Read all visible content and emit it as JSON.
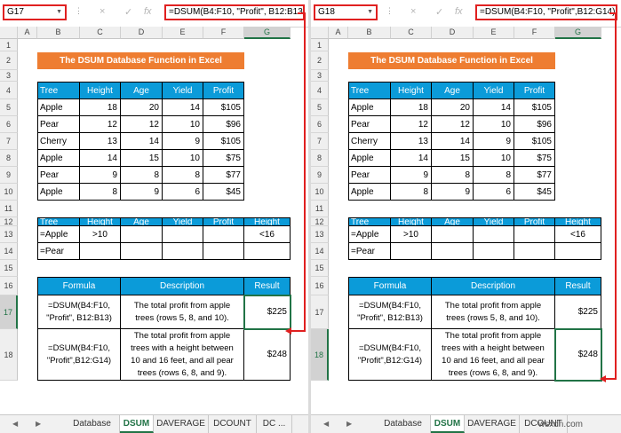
{
  "panes": [
    {
      "name_box": "G17",
      "formula": "=DSUM(B4:F10, \"Profit\", B12:B13)",
      "columns": [
        "A",
        "B",
        "C",
        "D",
        "E",
        "F",
        "G"
      ],
      "rows": [
        "1",
        "2",
        "3",
        "4",
        "5",
        "6",
        "7",
        "8",
        "9",
        "10",
        "11",
        "12",
        "13",
        "14",
        "15",
        "16",
        "17",
        "18"
      ],
      "title": "The DSUM Database Function in Excel",
      "db_headers": [
        "Tree",
        "Height",
        "Age",
        "Yield",
        "Profit"
      ],
      "db_rows": [
        [
          "Apple",
          "18",
          "20",
          "14",
          "$105"
        ],
        [
          "Pear",
          "12",
          "12",
          "10",
          "$96"
        ],
        [
          "Cherry",
          "13",
          "14",
          "9",
          "$105"
        ],
        [
          "Apple",
          "14",
          "15",
          "10",
          "$75"
        ],
        [
          "Pear",
          "9",
          "8",
          "8",
          "$77"
        ],
        [
          "Apple",
          "8",
          "9",
          "6",
          "$45"
        ]
      ],
      "crit_headers": [
        "Tree",
        "Height",
        "Age",
        "Yield",
        "Profit",
        "Height"
      ],
      "crit_row1": [
        "=Apple",
        ">10",
        "",
        "",
        "",
        "<16"
      ],
      "crit_row2": [
        "=Pear",
        "",
        "",
        "",
        "",
        ""
      ],
      "res_headers": [
        "Formula",
        "Description",
        "Result"
      ],
      "res_row1": {
        "formula": "=DSUM(B4:F10, \"Profit\", B12:B13)",
        "description": "The total profit from apple trees (rows 5, 8, and 10).",
        "result": "$225"
      },
      "res_row2": {
        "formula": "=DSUM(B4:F10, \"Profit\",B12:G14)",
        "description": "The total profit from apple trees with a height between 10 and 16 feet, and all pear trees (rows 6, 8, and 9).",
        "result": "$248"
      },
      "tabs": [
        "Database",
        "DSUM",
        "DAVERAGE",
        "DCOUNT",
        "DC ..."
      ]
    },
    {
      "name_box": "G18",
      "formula": "=DSUM(B4:F10, \"Profit\",B12:G14)",
      "columns": [
        "A",
        "B",
        "C",
        "D",
        "E",
        "F",
        "G"
      ],
      "rows": [
        "1",
        "2",
        "3",
        "4",
        "5",
        "6",
        "7",
        "8",
        "9",
        "10",
        "11",
        "12",
        "13",
        "14",
        "15",
        "16",
        "17",
        "18"
      ],
      "title": "The DSUM Database Function in Excel",
      "db_headers": [
        "Tree",
        "Height",
        "Age",
        "Yield",
        "Profit"
      ],
      "db_rows": [
        [
          "Apple",
          "18",
          "20",
          "14",
          "$105"
        ],
        [
          "Pear",
          "12",
          "12",
          "10",
          "$96"
        ],
        [
          "Cherry",
          "13",
          "14",
          "9",
          "$105"
        ],
        [
          "Apple",
          "14",
          "15",
          "10",
          "$75"
        ],
        [
          "Pear",
          "9",
          "8",
          "8",
          "$77"
        ],
        [
          "Apple",
          "8",
          "9",
          "6",
          "$45"
        ]
      ],
      "crit_headers": [
        "Tree",
        "Height",
        "Age",
        "Yield",
        "Profit",
        "Height"
      ],
      "crit_row1": [
        "=Apple",
        ">10",
        "",
        "",
        "",
        "<16"
      ],
      "crit_row2": [
        "=Pear",
        "",
        "",
        "",
        "",
        ""
      ],
      "res_headers": [
        "Formula",
        "Description",
        "Result"
      ],
      "res_row1": {
        "formula": "=DSUM(B4:F10, \"Profit\", B12:B13)",
        "description": "The total profit from apple trees (rows 5, 8, and 10).",
        "result": "$225"
      },
      "res_row2": {
        "formula": "=DSUM(B4:F10, \"Profit\",B12:G14)",
        "description": "The total profit from apple trees with a height between 10 and 16 feet, and all pear trees (rows 6, 8, and 9).",
        "result": "$248"
      },
      "tabs": [
        "Database",
        "DSUM",
        "DAVERAGE",
        "DCOUNT"
      ]
    }
  ],
  "icons": {
    "cancel": "×",
    "enter": "✓",
    "function": "fx"
  },
  "watermark": "wsxdn.com",
  "colors": {
    "title_fill": "#ee7d31",
    "header_fill": "#0b9bd9",
    "accent": "#217346",
    "callout": "#e02020"
  }
}
